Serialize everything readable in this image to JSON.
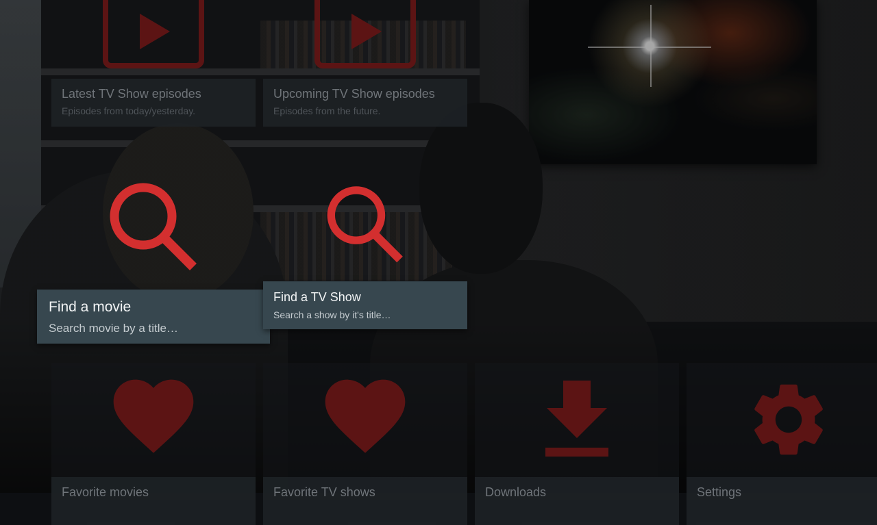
{
  "colors": {
    "accent": "#d32f2f",
    "accent_dim": "#5c1414",
    "caption_bg": "#37474f"
  },
  "row1": [
    {
      "icon": "play-icon",
      "title": "Latest TV Show episodes",
      "subtitle": "Episodes from today/yesterday."
    },
    {
      "icon": "play-icon",
      "title": "Upcoming TV Show episodes",
      "subtitle": "Episodes from the future."
    }
  ],
  "row2": [
    {
      "icon": "search-icon",
      "title": "Find a movie",
      "subtitle": "Search movie by a title…"
    },
    {
      "icon": "search-icon",
      "title": "Find a TV Show",
      "subtitle": "Search a show by it's title…"
    }
  ],
  "row3": [
    {
      "icon": "heart-icon",
      "title": "Favorite movies"
    },
    {
      "icon": "heart-icon",
      "title": "Favorite TV shows"
    },
    {
      "icon": "download-icon",
      "title": "Downloads"
    },
    {
      "icon": "gear-icon",
      "title": "Settings"
    }
  ]
}
